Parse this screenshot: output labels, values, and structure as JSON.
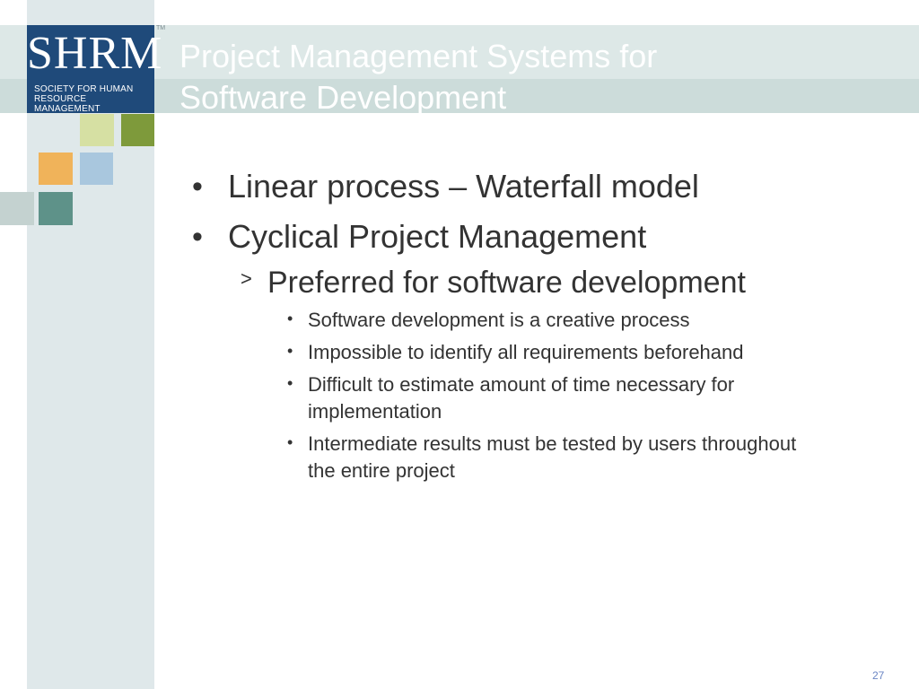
{
  "logo": {
    "letters": "SHRM",
    "subtitle_line1": "SOCIETY FOR HUMAN",
    "subtitle_line2": "RESOURCE MANAGEMENT",
    "trademark": "TM"
  },
  "colors": {
    "logo_blue": "#1f4a7a",
    "sidebar": "#dfe8ea",
    "title_band": "#dde8e7",
    "text": "#333333",
    "page_number": "#6b86c4",
    "squares": [
      "#d6e0a3",
      "#7e9a3b",
      "#f0b35a",
      "#a9c7de",
      "#c4d2d0",
      "#5e9289"
    ]
  },
  "slide": {
    "title_line1": "Project Management Systems for",
    "title_line2": "Software Development",
    "bullets": [
      "Linear process – Waterfall model",
      "Cyclical Project Management"
    ],
    "sub_bullet": "Preferred for software development",
    "sub_sub_bullets": [
      "Software development is a creative process",
      "Impossible to identify all requirements beforehand",
      "Difficult to estimate amount of time necessary for implementation",
      "Intermediate results must be tested by users throughout the entire project"
    ],
    "page_number": "27"
  }
}
